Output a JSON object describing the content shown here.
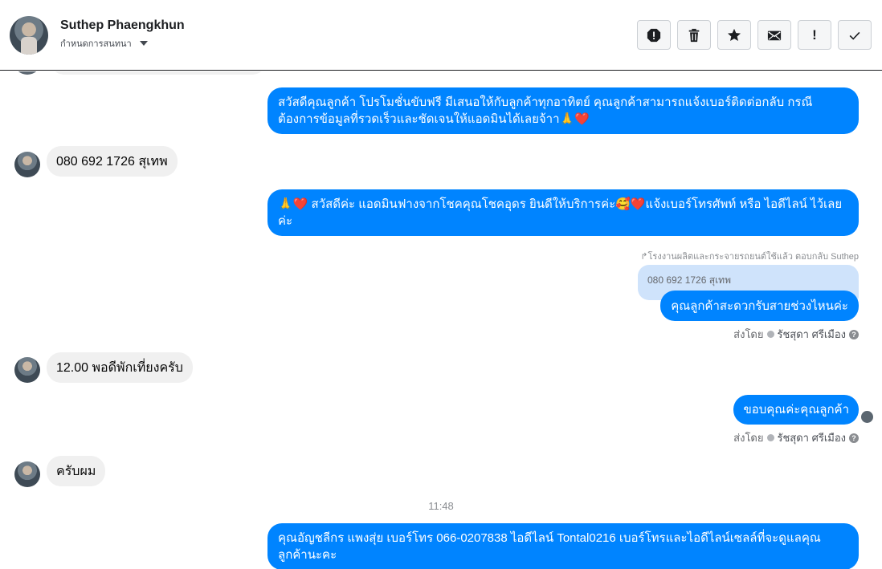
{
  "header": {
    "contact_name": "Suthep Phaengkhun",
    "subtitle": "กำหนดการสนทนา",
    "actions": [
      "spam-icon",
      "trash-icon",
      "star-icon",
      "envelope-icon",
      "exclamation-icon",
      "check-icon"
    ]
  },
  "messages": {
    "m1": "สวัสดีคุณลูกค้า โปรโมชั่นขับฟรี มีเสนอให้กับลูกค้าทุกอาทิตย์ คุณลูกค้าสามารถแจ้งเบอร์ติดต่อกลับ กรณีต้องการข้อมูลที่รวดเร็วและชัดเจนให้แอดมินได้เลยจ้าา🙏❤️",
    "m2": "080 692 1726 สุเทพ",
    "m3": "🙏❤️ สวัสดีค่ะ แอดมินฟางจากโชคคุณโชคอุดร ยินดีให้บริการค่ะ🥰❤️แจ้งเบอร์โทรศัพท์ หรือ ไอดีไลน์  ไว้เลยค่ะ",
    "reply_note": "โรงงานผลิตและกระจายรถยนต์ใช้แล้ว ตอบกลับ Suthep",
    "reply_quote": "080 692 1726 สุเทพ",
    "m4": "คุณลูกค้าสะดวกรับสายช่วงไหนค่ะ",
    "m5": "12.00 พอดีพักเที่ยงครับ",
    "m6": "ขอบคุณค่ะคุณลูกค้า",
    "m7": "ครับผม",
    "time": "11:48",
    "m8": "คุณอัญชลีกร แพงสุ่ย      เบอร์โทร 066-0207838 ไอดีไลน์ Tontal0216   เบอร์โทรและไอดีไลน์เซลล์ที่จะดูแลคุณลูกค้านะคะ"
  },
  "sent_by": {
    "prefix": "ส่งโดย",
    "agent": "รัชสุดา ศรีเมือง",
    "help": "?"
  },
  "colors": {
    "outgoing_bubble": "#0084ff",
    "incoming_bubble": "#f0f0f0",
    "reply_quote_bg": "#cfe3fb"
  }
}
